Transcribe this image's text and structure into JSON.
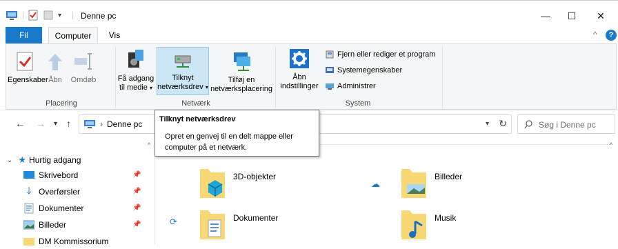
{
  "window": {
    "title": "Denne pc",
    "controls": {
      "minimize": "—",
      "maximize": "☐",
      "close": "✕"
    }
  },
  "ribbon": {
    "tabs": {
      "file": "Fil",
      "computer": "Computer",
      "view": "Vis"
    },
    "groups": {
      "placering": "Placering",
      "netvaerk": "Netværk",
      "system": "System"
    },
    "buttons": {
      "egenskaber": "Egenskaber",
      "aabn": "Åbn",
      "omdoeb": "Omdøb",
      "faa_adgang_1": "Få adgang",
      "faa_adgang_2": "til medie",
      "tilknyt_1": "Tilknyt",
      "tilknyt_2": "netværksdrev",
      "tilfoej_1": "Tilføj en",
      "tilfoej_2": "netværksplacering",
      "aabn_ind_1": "Åbn",
      "aabn_ind_2": "indstillinger",
      "fjern": "Fjern eller rediger et program",
      "systemegenskaber": "Systemegenskaber",
      "administrer": "Administrer"
    }
  },
  "address": {
    "path": "Denne pc",
    "search_placeholder": "Søg i Denne pc"
  },
  "tooltip": {
    "title": "Tilknyt netværksdrev",
    "body": "Opret en genvej til en delt mappe eller computer på et netværk."
  },
  "navpane": {
    "quick_access": "Hurtig adgang",
    "items": [
      {
        "label": "Skrivebord"
      },
      {
        "label": "Overførsler"
      },
      {
        "label": "Dokumenter"
      },
      {
        "label": "Billeder"
      },
      {
        "label": "DM Kommissorium"
      }
    ]
  },
  "folders": [
    {
      "label": "3D-objekter"
    },
    {
      "label": "Billeder"
    },
    {
      "label": "Dokumenter"
    },
    {
      "label": "Musik"
    }
  ],
  "colors": {
    "accent": "#1979ca",
    "folder": "#f8d775",
    "ribbon_bg": "#f5f6f7",
    "hover": "#cde6f7"
  }
}
